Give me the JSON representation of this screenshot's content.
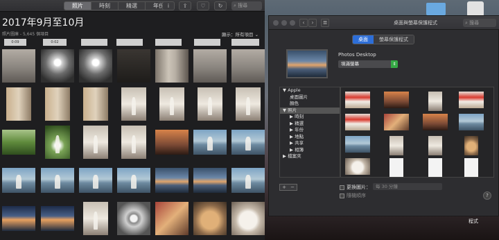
{
  "photos": {
    "tabs": [
      "照片",
      "時刻",
      "精選",
      "年份"
    ],
    "active_tab": "照片",
    "search_placeholder": "搜尋",
    "title": "2017年9月至10月",
    "subtitle": "照片圖庫 - 5,645 個項目",
    "view_label": "顯示：",
    "view_value": "所有項目",
    "strip_labels": [
      "0:09",
      "0:02"
    ],
    "grid": [
      [
        "room",
        "light",
        "light",
        "dark",
        "hallway",
        "room",
        "room"
      ],
      [
        "build",
        "build",
        "build",
        "wed",
        "wed",
        "wed",
        "wed"
      ],
      [
        "green",
        "greenb",
        "wed",
        "wed",
        "sunset",
        "sea",
        "sea"
      ],
      [
        "sea",
        "sea",
        "sea",
        "sea",
        "dusk",
        "dusk",
        "sea"
      ],
      [
        "dusk2",
        "dusk2",
        "wed",
        "table",
        "food",
        "dogtan",
        "dog"
      ]
    ]
  },
  "prefs": {
    "title": "桌面與螢幕保護程式",
    "search_placeholder": "搜尋",
    "tabs": [
      "桌面",
      "螢幕保護程式"
    ],
    "active_tab": "桌面",
    "current_name": "Photos Desktop",
    "fit_option": "填滿螢幕",
    "tree": [
      {
        "label": "▼ Apple",
        "indent": 0
      },
      {
        "label": "桌面圖片",
        "indent": 1
      },
      {
        "label": "顏色",
        "indent": 1
      },
      {
        "label": "▼ 照片",
        "indent": 0,
        "selected": true
      },
      {
        "label": "▶ 時刻",
        "indent": 1
      },
      {
        "label": "▶ 精選",
        "indent": 1
      },
      {
        "label": "▶ 年份",
        "indent": 1
      },
      {
        "label": "▶ 地點",
        "indent": 1
      },
      {
        "label": "▶ 共享",
        "indent": 1
      },
      {
        "label": "▶ 相簿",
        "indent": 1
      },
      {
        "label": "▶ 檔案夾",
        "indent": 0
      }
    ],
    "thumb_rows": [
      [
        "redsign",
        "sunset",
        "wed",
        "redsign"
      ],
      [
        "redsign",
        "food",
        "sunset",
        "sea"
      ],
      [
        "sea",
        "wed",
        "wed",
        "dogtan"
      ],
      [
        "dog",
        "doc",
        "doc",
        "doc"
      ]
    ],
    "add_label": "+",
    "remove_label": "−",
    "change_picture_label": "更換圖片：",
    "interval_value": "每 30 分鐘",
    "random_label": "隨機順序",
    "help_label": "?"
  },
  "desktop": {
    "dock_label": "程式"
  }
}
